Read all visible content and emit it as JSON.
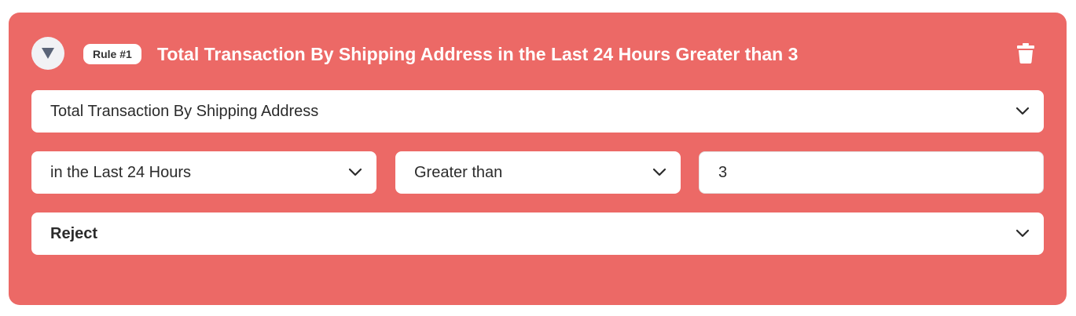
{
  "rule": {
    "badge": "Rule #1",
    "title": "Total Transaction By Shipping Address in the Last 24 Hours Greater than 3",
    "icons": {
      "collapse": "caret-down-icon",
      "delete": "trash-icon",
      "dropdown": "chevron-down-icon"
    },
    "fields": {
      "metric": "Total Transaction By Shipping Address",
      "period": "in the Last 24 Hours",
      "operator": "Greater than",
      "value": "3",
      "action": "Reject"
    }
  },
  "colors": {
    "card_background": "#ec6966",
    "field_background": "#ffffff",
    "collapse_button": "#f1f2f5",
    "caret": "#5a6478"
  }
}
